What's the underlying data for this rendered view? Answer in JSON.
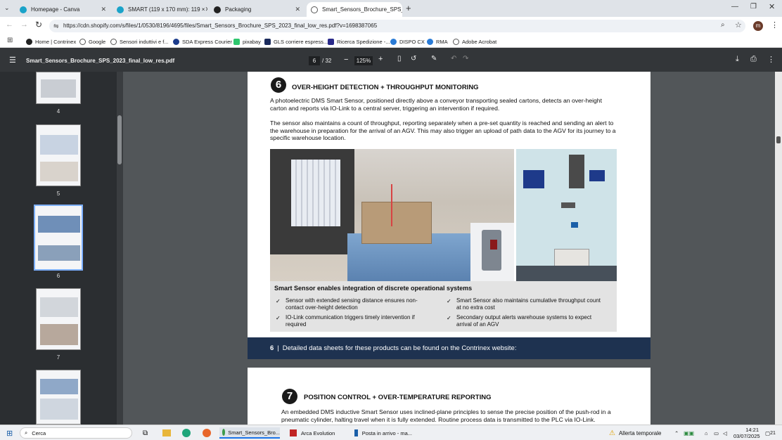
{
  "tabs": [
    {
      "label": "Homepage - Canva"
    },
    {
      "label": "SMART (119 x 170 mm): 119 ×"
    },
    {
      "label": "Packaging"
    },
    {
      "label": "Smart_Sensors_Brochure_SPS_2"
    }
  ],
  "url": "https://cdn.shopify.com/s/files/1/0530/8196/4695/files/Smart_Sensors_Brochure_SPS_2023_final_low_res.pdf?v=1698387065",
  "profile_initial": "m",
  "bookmarks": [
    "Home | Contrinex",
    "Google",
    "Sensori induttivi e f...",
    "SDA Express Courier",
    "pixabay",
    "GLS corriere espress...",
    "Ricerca Spedizione -...",
    "DISPO CX",
    "RMA",
    "Adobe Acrobat"
  ],
  "pdf": {
    "filename": "Smart_Sensors_Brochure_SPS_2023_final_low_res.pdf",
    "page_current": "6",
    "page_total": "/ 32",
    "zoom": "125%"
  },
  "thumbnails": [
    {
      "label": "4"
    },
    {
      "label": "5"
    },
    {
      "label": "6"
    },
    {
      "label": "7"
    }
  ],
  "section6": {
    "number": "6",
    "title": "OVER-HEIGHT DETECTION + THROUGHPUT MONITORING",
    "para1": "A photoelectric DMS Smart Sensor, positioned directly above a conveyor transporting sealed cartons, detects an over-height carton and reports via IO-Link to a central server, triggering an intervention if required.",
    "para2": "The sensor also maintains a count of throughput, reporting separately when a pre-set quantity is reached and sending an alert to the warehouse in preparation for the arrival of an AGV. This may also trigger an upload of path data to the AGV for its journey to a specific warehouse location.",
    "box_title": "Smart Sensor enables integration of discrete operational systems",
    "bullets": [
      "Sensor with extended sensing distance ensures non-contact over-height detection",
      "Smart Sensor also maintains cumulative throughput count at no extra cost",
      "IO-Link communication triggers timely intervention if required",
      "Secondary output alerts warehouse systems to expect arrival of an AGV"
    ],
    "footer_num": "6",
    "footer_text": "Detailed data sheets for these products can be found on the Contrinex website:"
  },
  "section7": {
    "number": "7",
    "title": "POSITION CONTROL + OVER-TEMPERATURE REPORTING",
    "para1": "An embedded DMS inductive Smart Sensor uses inclined-plane principles to sense the precise position of the push-rod in a pneumatic cylinder, halting travel when it is fully extended. Routine process data is transmitted to the PLC via IO-Link."
  },
  "taskbar": {
    "search": "Cerca",
    "apps": [
      "Smart_Sensors_Bro...",
      "Arca Evolution",
      "Posta in arrivo - ma..."
    ],
    "weather": "Allerta temporale",
    "time": "14:21",
    "date": "03/07/2025",
    "notif": "21"
  },
  "colors": {
    "footer_band": "#1e3250",
    "accent_blue": "#1a73e8"
  }
}
